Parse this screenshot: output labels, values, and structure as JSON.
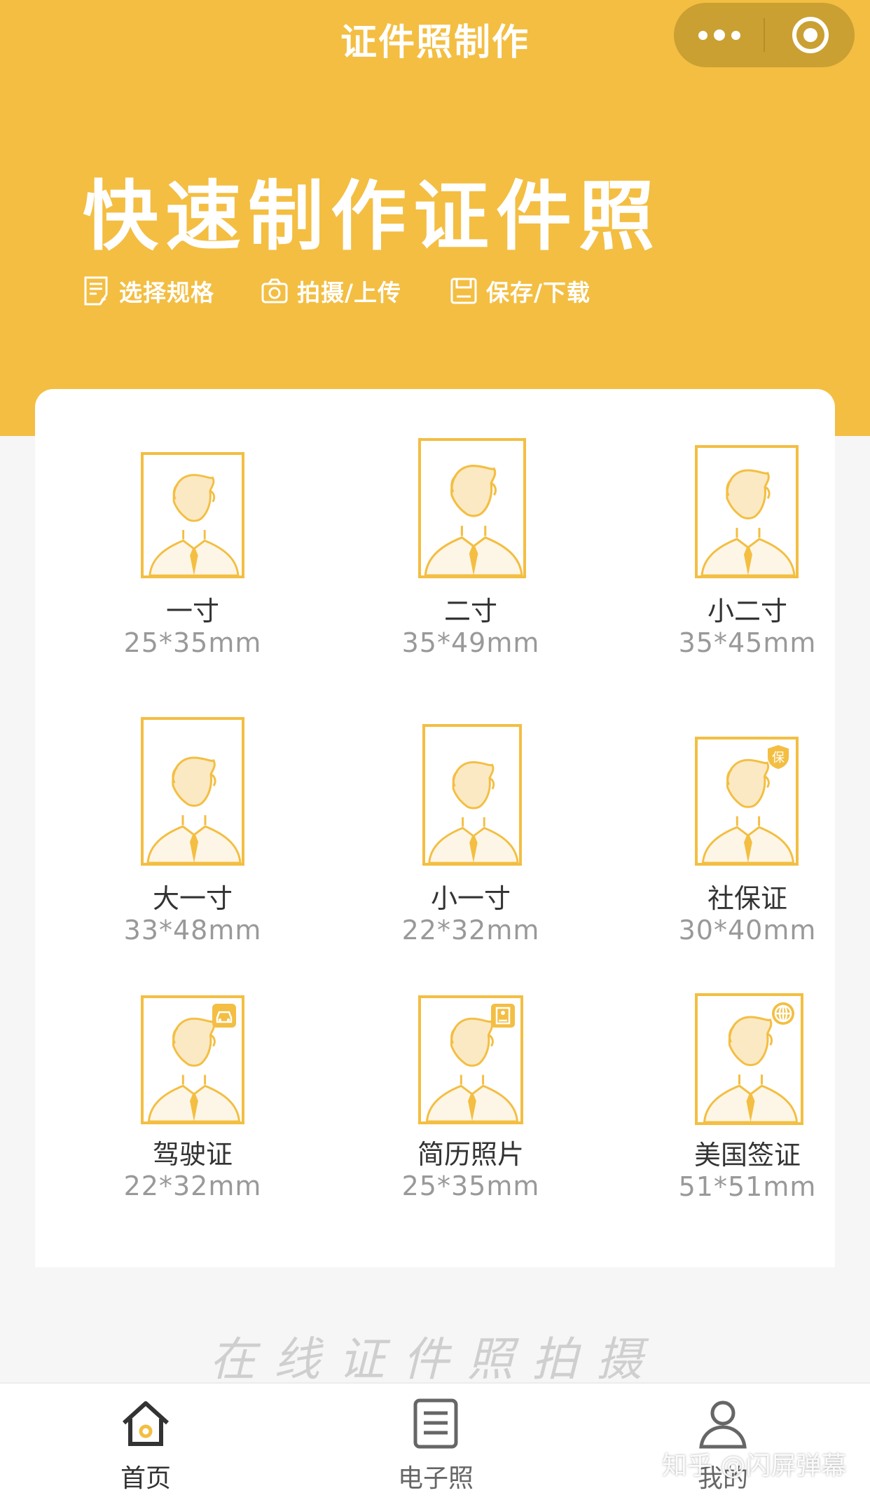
{
  "nav": {
    "title": "证件照制作"
  },
  "hero": {
    "headline": "快速制作证件照",
    "steps": [
      {
        "label": "选择规格",
        "icon": "checklist-icon"
      },
      {
        "label": "拍摄/上传",
        "icon": "camera-icon"
      },
      {
        "label": "保存/下载",
        "icon": "save-icon"
      }
    ]
  },
  "specs": [
    {
      "name": "一寸",
      "size": "25*35mm"
    },
    {
      "name": "二寸",
      "size": "35*49mm"
    },
    {
      "name": "小二寸",
      "size": "35*45mm"
    },
    {
      "name": "大一寸",
      "size": "33*48mm"
    },
    {
      "name": "小一寸",
      "size": "22*32mm"
    },
    {
      "name": "社保证",
      "size": "30*40mm",
      "badge": "保"
    },
    {
      "name": "驾驶证",
      "size": "22*32mm",
      "badge_icon": "car-icon"
    },
    {
      "name": "简历照片",
      "size": "25*35mm",
      "badge_icon": "resume-icon"
    },
    {
      "name": "美国签证",
      "size": "51*51mm",
      "badge_icon": "globe-icon"
    }
  ],
  "slogan": "在线证件照拍摄",
  "tabbar": [
    {
      "label": "首页",
      "icon": "home-icon",
      "active": true
    },
    {
      "label": "电子照",
      "icon": "document-icon",
      "active": false
    },
    {
      "label": "我的",
      "icon": "user-icon",
      "active": false
    }
  ],
  "watermark": "知乎 @闪屏弹幕",
  "colors": {
    "accent": "#f3be42",
    "capsule": "#caa032",
    "text": "#333333",
    "muted": "#999999"
  }
}
